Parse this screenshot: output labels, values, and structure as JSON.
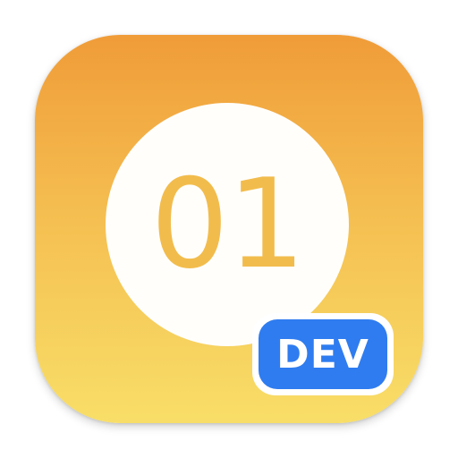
{
  "app_icon": {
    "number_label": "01",
    "badge_label": "DEV",
    "colors": {
      "gradient_top": "#f09c38",
      "gradient_bottom": "#f8de68",
      "disc": "#fffefb",
      "number": "#f2bc4c",
      "badge": "#2f7cf0",
      "badge_text": "#ffffff"
    }
  }
}
